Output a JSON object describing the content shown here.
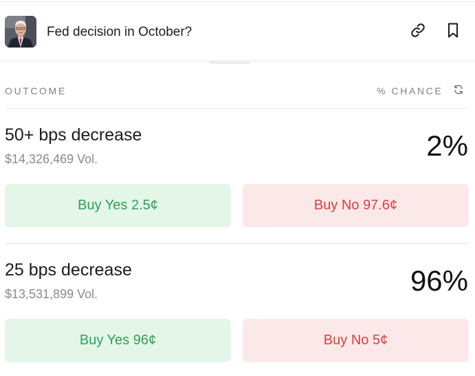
{
  "header": {
    "title": "Fed decision in October?"
  },
  "icons": {
    "link": "link-icon",
    "bookmark": "bookmark-icon",
    "refresh": "refresh-icon"
  },
  "columns": {
    "outcome": "OUTCOME",
    "chance": "% CHANCE"
  },
  "outcomes": [
    {
      "name": "50+ bps decrease",
      "volume": "$14,326,469 Vol.",
      "chance": "2%",
      "buy_yes": "Buy Yes 2.5¢",
      "buy_no": "Buy No 97.6¢"
    },
    {
      "name": "25 bps decrease",
      "volume": "$13,531,899 Vol.",
      "chance": "96%",
      "buy_yes": "Buy Yes 96¢",
      "buy_no": "Buy No 5¢"
    }
  ],
  "colors": {
    "yes_bg": "#e3f6e8",
    "yes_text": "#2f9e5b",
    "no_bg": "#fbe9e9",
    "no_text": "#e03c3c"
  }
}
